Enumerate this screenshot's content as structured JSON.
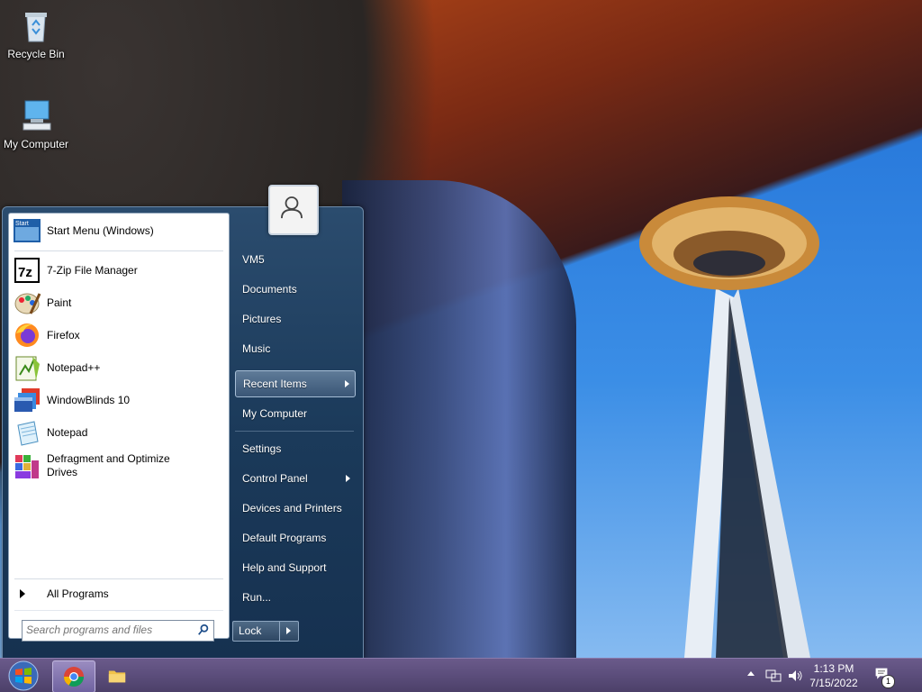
{
  "desktop": {
    "icons": [
      {
        "label": "Recycle Bin",
        "icon": "recycle-bin-icon"
      },
      {
        "label": "My Computer",
        "icon": "computer-icon"
      }
    ]
  },
  "start_menu": {
    "programs": [
      {
        "label": "Start Menu (Windows)",
        "icon": "start-menu-icon"
      },
      {
        "label": "7-Zip File Manager",
        "icon": "7zip-icon"
      },
      {
        "label": "Paint",
        "icon": "paint-icon"
      },
      {
        "label": "Firefox",
        "icon": "firefox-icon"
      },
      {
        "label": "Notepad++",
        "icon": "notepadpp-icon"
      },
      {
        "label": "WindowBlinds 10",
        "icon": "windowblinds-icon"
      },
      {
        "label": "Notepad",
        "icon": "notepad-icon"
      },
      {
        "label": "Defragment and Optimize\nDrives",
        "icon": "defrag-icon"
      }
    ],
    "all_programs": "All Programs",
    "search_placeholder": "Search programs and files",
    "right_items": [
      {
        "label": "VM5"
      },
      {
        "label": "Documents"
      },
      {
        "label": "Pictures"
      },
      {
        "label": "Music"
      },
      {
        "label": "Recent Items",
        "submenu": true,
        "highlighted": true
      },
      {
        "label": "My Computer"
      },
      {
        "label": "Settings"
      },
      {
        "label": "Control Panel",
        "submenu": true
      },
      {
        "label": "Devices and Printers"
      },
      {
        "label": "Default Programs"
      },
      {
        "label": "Help and Support"
      },
      {
        "label": "Run..."
      }
    ],
    "lock_label": "Lock"
  },
  "taskbar": {
    "pinned": [
      {
        "name": "start-orb",
        "icon": "windows-logo-icon"
      },
      {
        "name": "chrome",
        "icon": "chrome-icon",
        "active": true
      },
      {
        "name": "file-explorer",
        "icon": "folder-icon"
      }
    ],
    "tray": {
      "time": "1:13 PM",
      "date": "7/15/2022",
      "notification_count": "1"
    }
  }
}
